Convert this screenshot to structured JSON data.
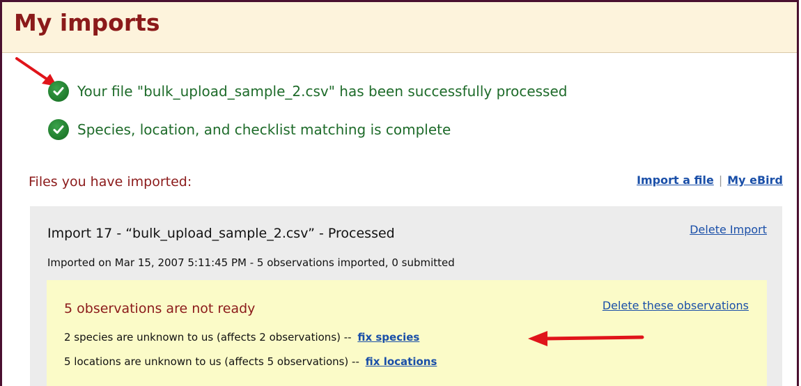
{
  "page": {
    "title": "My imports"
  },
  "status": [
    {
      "text": "Your file \"bulk_upload_sample_2.csv\" has been successfully processed",
      "icon": "check-circle-icon"
    },
    {
      "text": "Species, location, and checklist matching is complete",
      "icon": "check-circle-icon"
    }
  ],
  "files": {
    "heading": "Files you have imported:",
    "links": {
      "import_file": "Import a file",
      "separator": "|",
      "my_ebird": "My eBird"
    }
  },
  "import": {
    "title": "Import 17 - “bulk_upload_sample_2.csv” - Processed",
    "delete_label": "Delete Import",
    "meta": "Imported on Mar 15, 2007 5:11:45 PM - 5 observations imported, 0 submitted",
    "not_ready": {
      "title": "5 observations are not ready",
      "delete_label": "Delete these observations",
      "species_text": "2 species are unknown to us (affects 2 observations) --",
      "species_link": "fix species",
      "locations_text": "5 locations are unknown to us (affects 5 observations) --",
      "locations_link": "fix locations"
    }
  },
  "colors": {
    "title": "#8b1a1a",
    "status_green": "#1e6b2a",
    "link": "#1a4fa8",
    "arrow": "#e0141a",
    "header_bg": "#fdf3dc",
    "import_bg": "#ececec",
    "notready_bg": "#fbfbc8"
  }
}
